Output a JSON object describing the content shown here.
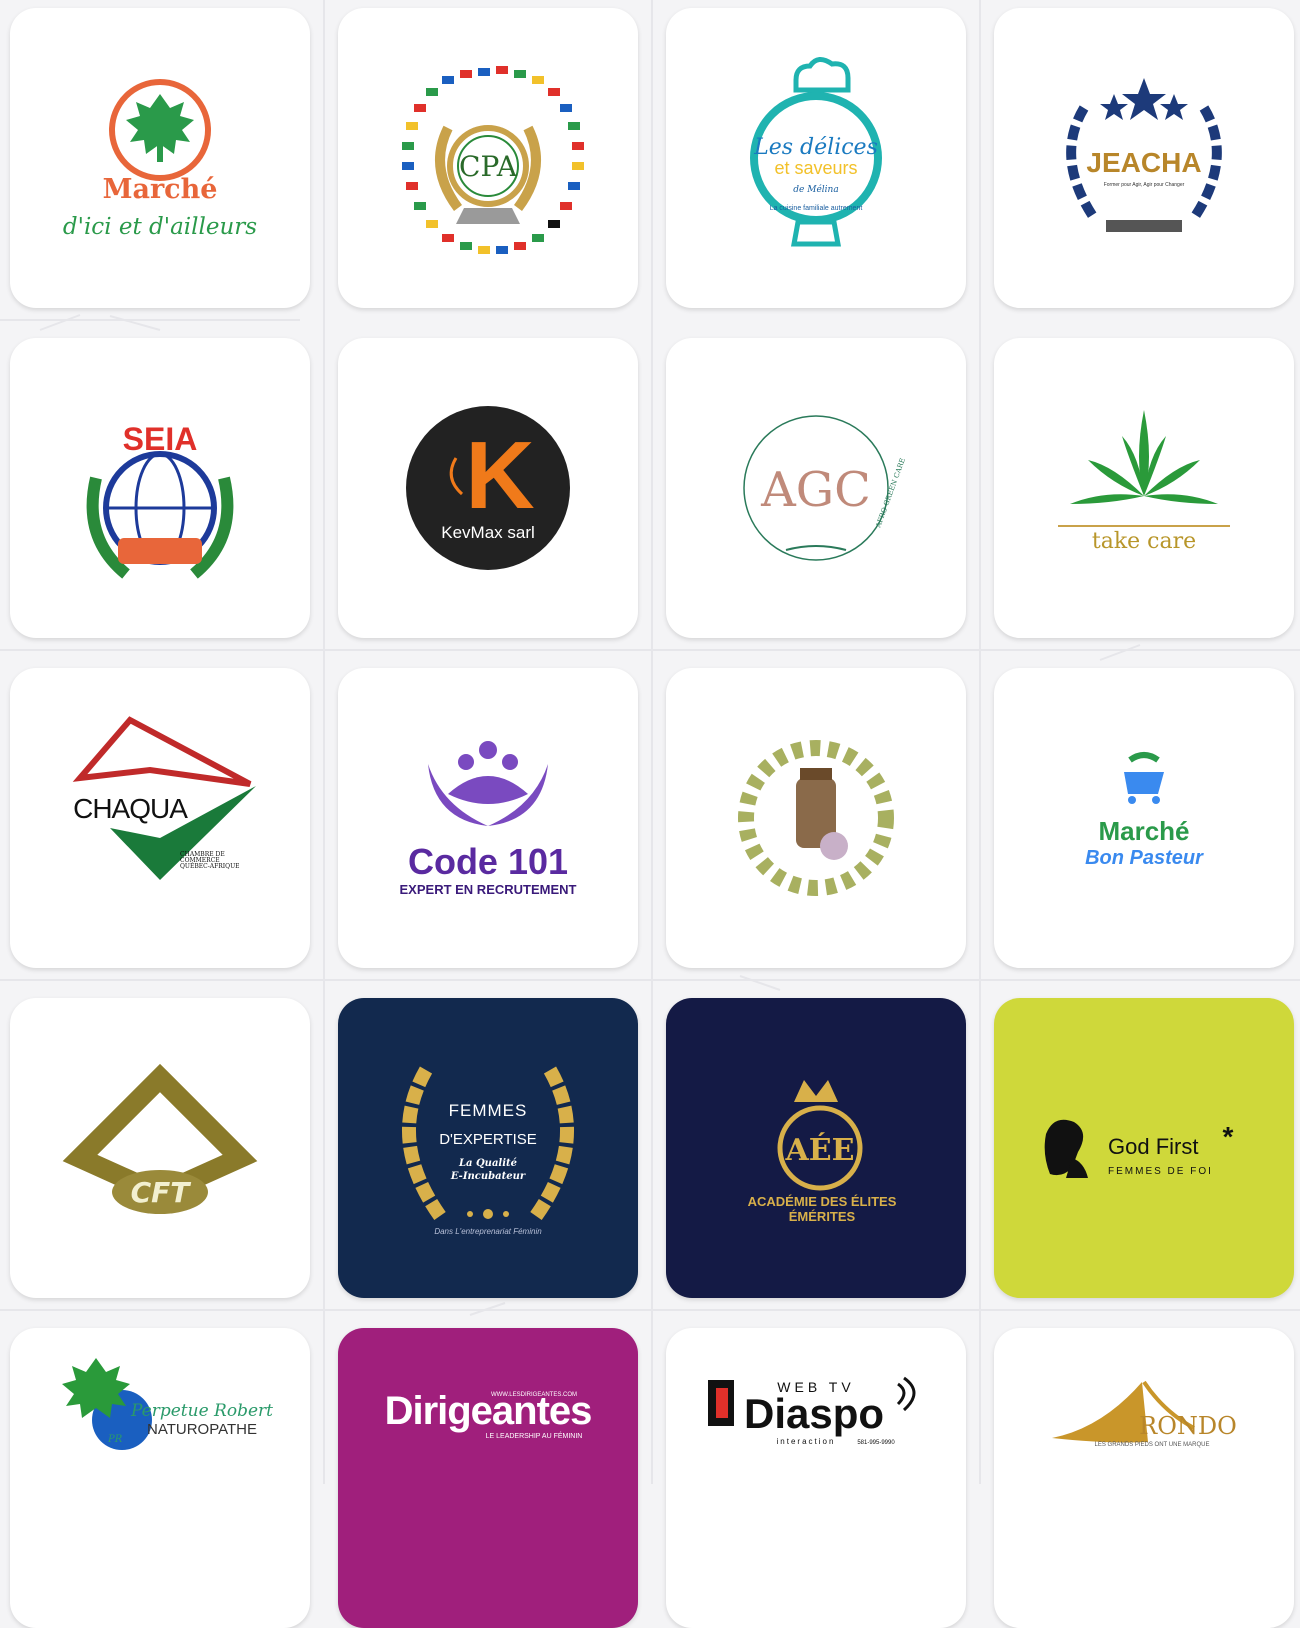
{
  "logos": [
    {
      "name": "Marché d'ici et d'ailleurs",
      "line1": "Marché",
      "line2": "d'ici et d'ailleurs"
    },
    {
      "name": "CPA",
      "text": "CPA"
    },
    {
      "name": "Les délices et saveurs",
      "line1": "Les délices",
      "line2": "et saveurs",
      "line3": "de Mélina",
      "ring": "La cuisine familiale autrement"
    },
    {
      "name": "JEACHA",
      "text": "JEACHA",
      "tagline": "Former pour Agir, Agir pour Changer"
    },
    {
      "name": "SEIA",
      "text": "SEIA"
    },
    {
      "name": "KevMax sarl",
      "letter": "K",
      "text": "KevMax sarl"
    },
    {
      "name": "Afro Green Care",
      "letters": "AGC",
      "ring": "AFRO GREEN CARE"
    },
    {
      "name": "Take care",
      "text": "take care"
    },
    {
      "name": "CHAQUA",
      "text": "CHAQUA",
      "sub1": "CHAMBRE DE",
      "sub2": "COMMERCE",
      "sub3": "QUÉBEC-AFRIQUE"
    },
    {
      "name": "Code 101",
      "text": "Code 101",
      "sub": "EXPERT EN RECRUTEMENT"
    },
    {
      "name": "Botanical jar",
      "text": ""
    },
    {
      "name": "Marché Bon Pasteur",
      "line1": "Marché",
      "line2": "Bon Pasteur"
    },
    {
      "name": "CFT",
      "text": "CFT"
    },
    {
      "name": "Femmes d'Expertise",
      "line1": "FEMMES",
      "line2": "D'EXPERTISE",
      "line3": "La Qualité",
      "line4": "E-Incubateur",
      "line5": "Dans L'entreprenariat Féminin"
    },
    {
      "name": "Académie des Élites Émérites",
      "letters": "AÉE",
      "line1": "ACADÉMIE DES ÉLITES",
      "line2": "ÉMÉRITES"
    },
    {
      "name": "God First",
      "line1": "God First",
      "line2": "FEMMES DE FOI",
      "star": "*"
    },
    {
      "name": "Perpetue Robert",
      "line1": "Perpetue Robert",
      "line2": "NATUROPATHE",
      "initials": "PR"
    },
    {
      "name": "Dirigeantes",
      "url": "WWW.LESDIRIGEANTES.COM",
      "text": "Dirigeantes",
      "sub": "LE LEADERSHIP AU FÉMININ"
    },
    {
      "name": "Diaspo",
      "top": "WEB TV",
      "text": "Diaspo",
      "sub": "interaction",
      "phone": "581-995-9990"
    },
    {
      "name": "Arondo",
      "text": "RONDO",
      "sub": "LES GRANDS PIEDS ONT UNE MARQUE"
    }
  ],
  "colors": {
    "background": "#f4f4f6",
    "card": "#ffffff",
    "navy": "#12294e",
    "indigo": "#141a45",
    "lime": "#cfd83a",
    "magenta": "#a01f7c",
    "orange": "#e8663a",
    "green": "#2a9a4a",
    "purple": "#6a3fb0",
    "gold": "#c9a24a",
    "teal": "#1fb3b0"
  }
}
